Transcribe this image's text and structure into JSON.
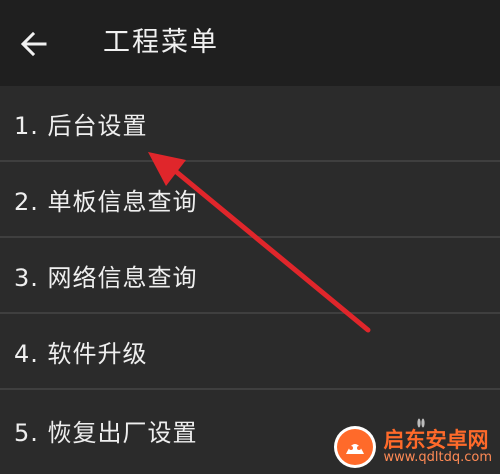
{
  "header": {
    "title": "工程菜单",
    "back_icon": "arrow-left-icon"
  },
  "menu": {
    "items": [
      {
        "label": "1. 后台设置"
      },
      {
        "label": "2. 单板信息查询"
      },
      {
        "label": "3. 网络信息查询"
      },
      {
        "label": "4. 软件升级"
      },
      {
        "label": "5. 恢复出厂设置"
      }
    ]
  },
  "annotation": {
    "color": "#e0262b",
    "icon": "red-arrow-annotation"
  },
  "watermark": {
    "text": "启东安卓网",
    "url": "www.qdltdq.com"
  },
  "colors": {
    "background": "#2b2b2b",
    "app_bar": "#1f1f1f",
    "divider": "#3f3f3f",
    "text": "#efefef",
    "watermark": "#ff6a2a"
  }
}
